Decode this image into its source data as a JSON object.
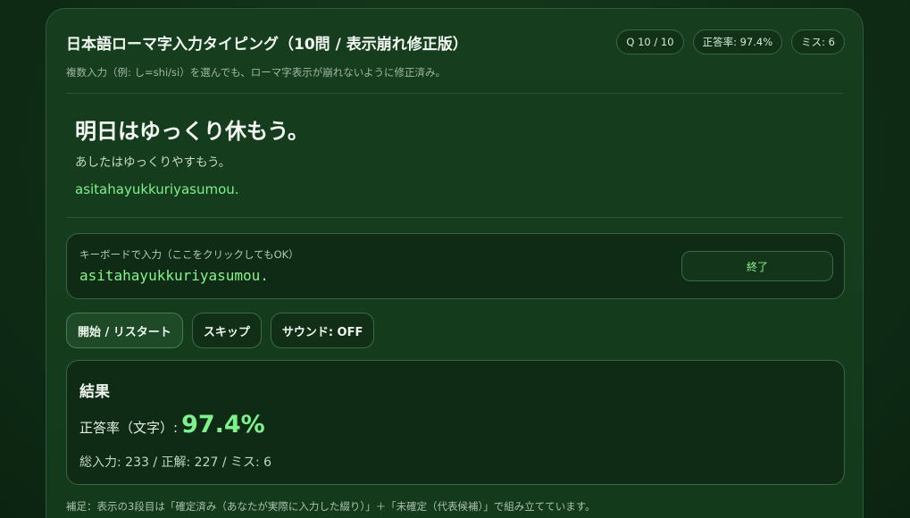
{
  "header": {
    "title": "日本語ローマ字入力タイピング（10問 / 表示崩れ修正版）",
    "subtitle": "複数入力（例: し=shi/si）を選んでも、ローマ字表示が崩れないように修正済み。",
    "question_counter": "Q 10 / 10",
    "accuracy_badge": "正答率: 97.4%",
    "miss_badge": "ミス: 6"
  },
  "question": {
    "kanji": "明日はゆっくり休もう。",
    "kana": "あしたはゆっくりやすもう。",
    "romaji": "asitahayukkuriyasumou."
  },
  "input_area": {
    "label": "キーボードで入力（ここをクリックしてもOK）",
    "value": "asitahayukkuriyasumou.",
    "finish_label": "終了"
  },
  "controls": {
    "restart_label": "開始 / リスタート",
    "skip_label": "スキップ",
    "sound_label": "サウンド: OFF"
  },
  "result": {
    "title": "結果",
    "accuracy_label": "正答率（文字）:",
    "accuracy_value": "97.4%",
    "stats": "総入力: 233 / 正解: 227 / ミス: 6"
  },
  "footer": {
    "note": "補足：表示の3段目は「確定済み（あなたが実際に入力した綴り）」＋「未確定（代表候補）」で組み立てています。"
  },
  "colors": {
    "accent": "#7ef08c",
    "background": "#0f2c16",
    "card": "#163d1e"
  }
}
